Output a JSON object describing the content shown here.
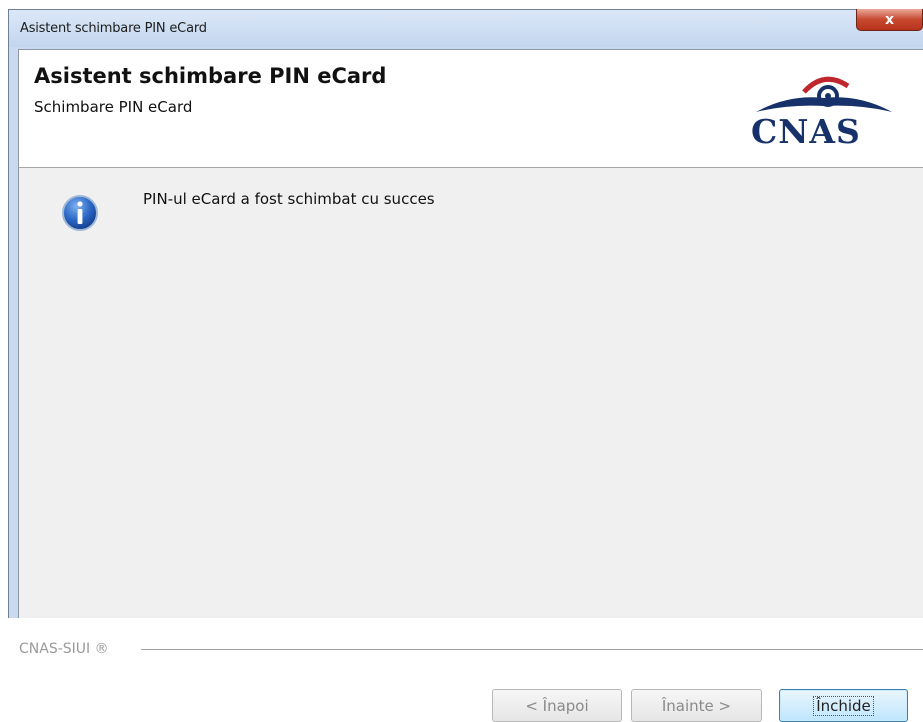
{
  "window": {
    "title": "Asistent schimbare PIN eCard",
    "close_symbol": "x"
  },
  "header": {
    "title": "Asistent schimbare PIN eCard",
    "subtitle": "Schimbare PIN eCard",
    "logo_text": "CNAS"
  },
  "body": {
    "icon": "info-icon",
    "message": "PIN-ul eCard a fost schimbat cu succes"
  },
  "footer": {
    "brand": "CNAS-SIUI ®"
  },
  "buttons": {
    "back": "< Înapoi",
    "next": "Înainte >",
    "close": "Închide"
  },
  "colors": {
    "accent": "#3c7fb1",
    "logo": "#17326a",
    "logo_swoosh": "#c0272d"
  }
}
